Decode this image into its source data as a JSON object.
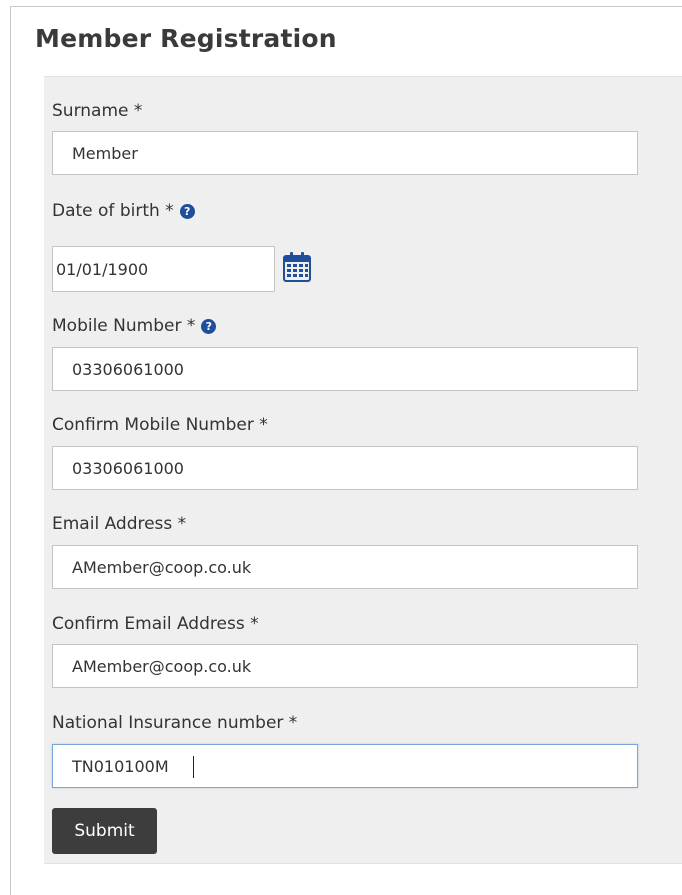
{
  "page": {
    "title": "Member Registration"
  },
  "form": {
    "surname": {
      "label": "Surname *",
      "value": "Member"
    },
    "date_of_birth": {
      "label": "Date of birth *",
      "value": "01/01/1900",
      "help_icon": "question-circle-icon",
      "picker_icon": "calendar-icon"
    },
    "mobile_number": {
      "label": "Mobile Number *",
      "value": "03306061000",
      "help_icon": "question-circle-icon"
    },
    "confirm_mobile_number": {
      "label": "Confirm Mobile Number *",
      "value": "03306061000"
    },
    "email_address": {
      "label": "Email Address *",
      "value": "AMember@coop.co.uk"
    },
    "confirm_email_address": {
      "label": "Confirm Email Address *",
      "value": "AMember@coop.co.uk"
    },
    "national_insurance_number": {
      "label": "National Insurance number *",
      "value": "TN010100M",
      "focused": true
    },
    "submit_label": "Submit"
  },
  "colors": {
    "panel_background": "#efefef",
    "help_icon": "#1f4e9a",
    "calendar_icon": "#1f4e9a",
    "submit_background": "#3d3d3d",
    "focus_border": "#7aa6d8"
  }
}
